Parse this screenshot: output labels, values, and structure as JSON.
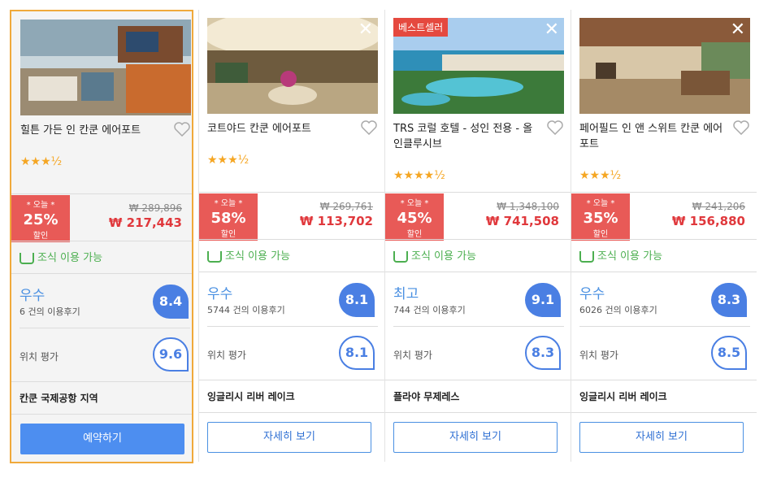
{
  "hotels": [
    {
      "name": "힐튼 가든 인 칸쿤 에어포트",
      "badge": "",
      "has_close": false,
      "stars": "★★★½",
      "deal_top": "* 오늘 *",
      "deal_pct": "25%",
      "deal_bottom": "할인",
      "old_price": "₩ 289,896",
      "new_price": "₩ 217,443",
      "breakfast": "조식 이용 가능",
      "rating_label": "우수",
      "reviews": "6 건의 이용후기",
      "score": "8.4",
      "location_label": "위치 평가",
      "location_score": "9.6",
      "area": "칸쿤 국제공항 지역",
      "button": "예약하기"
    },
    {
      "name": "코트야드 칸쿤 에어포트",
      "badge": "",
      "has_close": true,
      "stars": "★★★½",
      "deal_top": "* 오늘 *",
      "deal_pct": "58%",
      "deal_bottom": "할인",
      "old_price": "₩ 269,761",
      "new_price": "₩ 113,702",
      "breakfast": "조식 이용 가능",
      "rating_label": "우수",
      "reviews": "5744 건의 이용후기",
      "score": "8.1",
      "location_label": "위치 평가",
      "location_score": "8.1",
      "area": "잉글리시 리버 레이크",
      "button": "자세히 보기"
    },
    {
      "name": "TRS 코럴 호텔 - 성인 전용 - 올 인클루시브",
      "badge": "베스트셀러",
      "has_close": true,
      "stars": "★★★★½",
      "deal_top": "* 오늘 *",
      "deal_pct": "45%",
      "deal_bottom": "할인",
      "old_price": "₩ 1,348,100",
      "new_price": "₩ 741,508",
      "breakfast": "조식 이용 가능",
      "rating_label": "최고",
      "reviews": "744 건의 이용후기",
      "score": "9.1",
      "location_label": "위치 평가",
      "location_score": "8.3",
      "area": "플라야 무제레스",
      "button": "자세히 보기"
    },
    {
      "name": "페어필드 인 앤 스위트 칸쿤 에어포트",
      "badge": "",
      "has_close": true,
      "stars": "★★★½",
      "deal_top": "* 오늘 *",
      "deal_pct": "35%",
      "deal_bottom": "할인",
      "old_price": "₩ 241,206",
      "new_price": "₩ 156,880",
      "breakfast": "조식 이용 가능",
      "rating_label": "우수",
      "reviews": "6026 건의 이용후기",
      "score": "8.3",
      "location_label": "위치 평가",
      "location_score": "8.5",
      "area": "잉글리시 리버 레이크",
      "button": "자세히 보기"
    }
  ],
  "colors": {
    "accent": "#4a7fe3",
    "deal": "#e85a57",
    "price": "#e0383c",
    "selected_border": "#f0a93b",
    "breakfast": "#4caf50"
  }
}
